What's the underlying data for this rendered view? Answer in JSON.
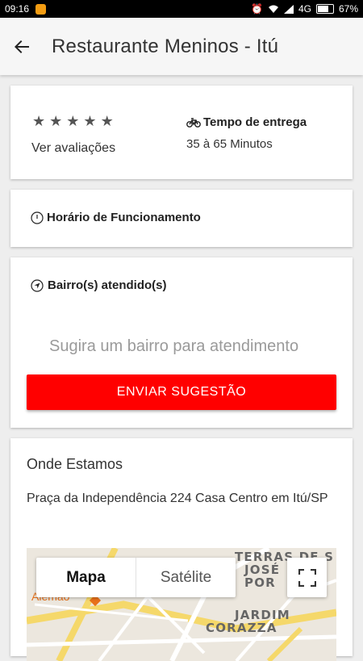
{
  "status_bar": {
    "time": "09:16",
    "network": "4G",
    "battery": "67%"
  },
  "app_bar": {
    "title": "Restaurante Meninos - Itú"
  },
  "rating": {
    "stars": [
      "★",
      "★",
      "★",
      "★",
      "★"
    ],
    "reviews_link": "Ver avaliações"
  },
  "delivery": {
    "title": "Tempo de entrega",
    "value": "35 à 65 Minutos"
  },
  "hours": {
    "title": "Horário de Funcionamento"
  },
  "neighborhoods": {
    "title": "Bairro(s) atendido(s)",
    "suggest_placeholder": "Sugira um bairro para atendimento",
    "send_button": "ENVIAR SUGESTÃO"
  },
  "location": {
    "title": "Onde Estamos",
    "address": "Praça da Independência 224 Casa Centro em Itú/SP",
    "map": {
      "tab_map": "Mapa",
      "tab_satellite": "Satélite",
      "labels": [
        "TERRAS DE S",
        "JOSÉ",
        "POR",
        "JARDIM",
        "CORAZZA"
      ],
      "partial_label": "Alemão"
    }
  },
  "colors": {
    "accent": "#ff0000",
    "marker": "#e8711a"
  }
}
